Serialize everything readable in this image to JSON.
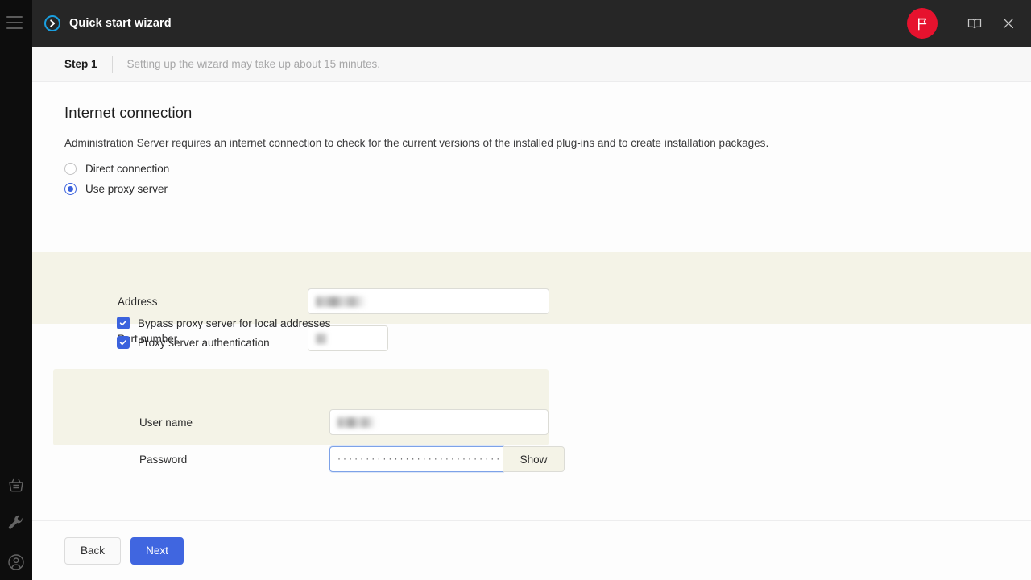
{
  "window": {
    "title": "Quick start wizard",
    "title_icon": "arrow-circle-icon",
    "flag_icon": "flag-icon",
    "help_icon": "book-icon",
    "close_icon": "close-icon",
    "menu_icon": "hamburger-menu-icon",
    "accent_blue": "#1a9fe0",
    "accent_red": "#e6122e",
    "titlebar_bg": "#262626"
  },
  "rail": {
    "items": [
      {
        "name": "marketplace-basket-icon",
        "label": "Marketplace"
      },
      {
        "name": "wrench-icon",
        "label": "Tools"
      },
      {
        "name": "user-account-icon",
        "label": "Account"
      }
    ]
  },
  "stepbar": {
    "step": "Step 1",
    "note": "Setting up the wizard may take up about 15 minutes."
  },
  "page": {
    "heading": "Internet connection",
    "description": "Administration Server requires an internet connection to check for the current versions of the installed plug-ins and to create installation packages."
  },
  "connection": {
    "options": [
      {
        "label": "Direct connection",
        "selected": false
      },
      {
        "label": "Use proxy server",
        "selected": true
      }
    ],
    "selected_color": "#3b62dd"
  },
  "proxy": {
    "address": {
      "label": "Address",
      "value": "",
      "redacted": true
    },
    "port": {
      "label": "Port number",
      "value": "",
      "redacted": true
    }
  },
  "checkboxes": [
    {
      "label": "Bypass proxy server for local addresses",
      "checked": true
    },
    {
      "label": "Proxy server authentication",
      "checked": true
    }
  ],
  "credentials": {
    "username": {
      "label": "User name",
      "value": "",
      "redacted": true
    },
    "password": {
      "label": "Password",
      "masked_value": "······························",
      "focused": true,
      "show_button": "Show"
    }
  },
  "footer": {
    "back": "Back",
    "next": "Next"
  }
}
